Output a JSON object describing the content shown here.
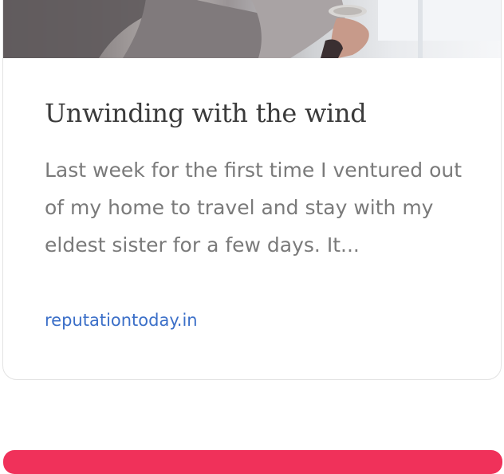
{
  "card": {
    "title": "Unwinding with the wind",
    "excerpt": "Last week for the first time I ventured out of my home to travel and stay with my eldest sister for a few days. It...",
    "source": "reputationtoday.in"
  },
  "colors": {
    "title": "#3a3a3a",
    "excerpt": "#7a7a7a",
    "link": "#3b6fc8",
    "accent_bar": "#f0315a"
  }
}
